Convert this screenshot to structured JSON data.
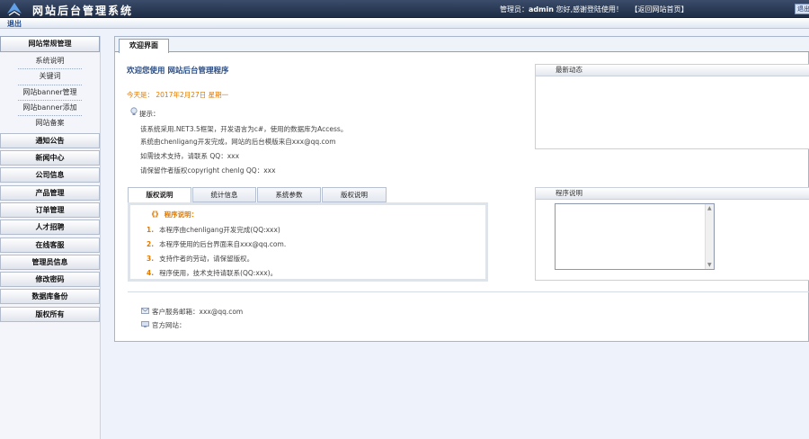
{
  "header": {
    "title": "网站后台管理系统",
    "admin_prefix": "管理员：",
    "admin_name": "admin",
    "welcome_text": "您好,感谢登陆使用！",
    "back_link": "【返回网站首页】",
    "logout_label": "退出",
    "sub_label": "退出"
  },
  "sidebar": {
    "section_title": "网站常规管理",
    "sub_items": [
      "系统说明",
      "关键词",
      "网站banner管理",
      "网站banner添加",
      "网站备案"
    ],
    "items": [
      "通知公告",
      "新闻中心",
      "公司信息",
      "产品管理",
      "订单管理",
      "人才招聘",
      "在线客服",
      "管理员信息",
      "修改密码",
      "数据库备份",
      "版权所有"
    ]
  },
  "main": {
    "tab_label": "欢迎界面",
    "welcome_heading": "欢迎您使用 网站后台管理程序",
    "date_line": "今天是： 2017年2月27日 星期一",
    "tips_label": "提示：",
    "tips": [
      "该系统采用.NET3.5框架，开发语言为c#，使用的数据库为Access。",
      "系统由chenligang开发完成，网站的后台模版来自xxx@qq.com",
      "如需技术支持，请联系 QQ：xxx",
      "请保留作者版权copyright chenlg QQ：xxx"
    ],
    "sub_tabs": [
      "版权说明",
      "统计信息",
      "系统参数",
      "版权说明"
    ],
    "info_title": "程序说明：",
    "info_lines": [
      {
        "num": "1.",
        "text": "本程序由chenligang开发完成(QQ:xxx)"
      },
      {
        "num": "2.",
        "text": "本程序使用的后台界面来自xxx@qq.com."
      },
      {
        "num": "3.",
        "text": "支持作者的劳动，请保留版权。"
      },
      {
        "num": "4.",
        "text": "程序使用，技术支持请联系(QQ:xxx)。"
      }
    ],
    "contact_email": "客户服务邮箱：xxx@qq.com",
    "contact_site": "官方网站："
  },
  "panels": {
    "news_title": "最新动态",
    "program_title": "程序说明"
  }
}
